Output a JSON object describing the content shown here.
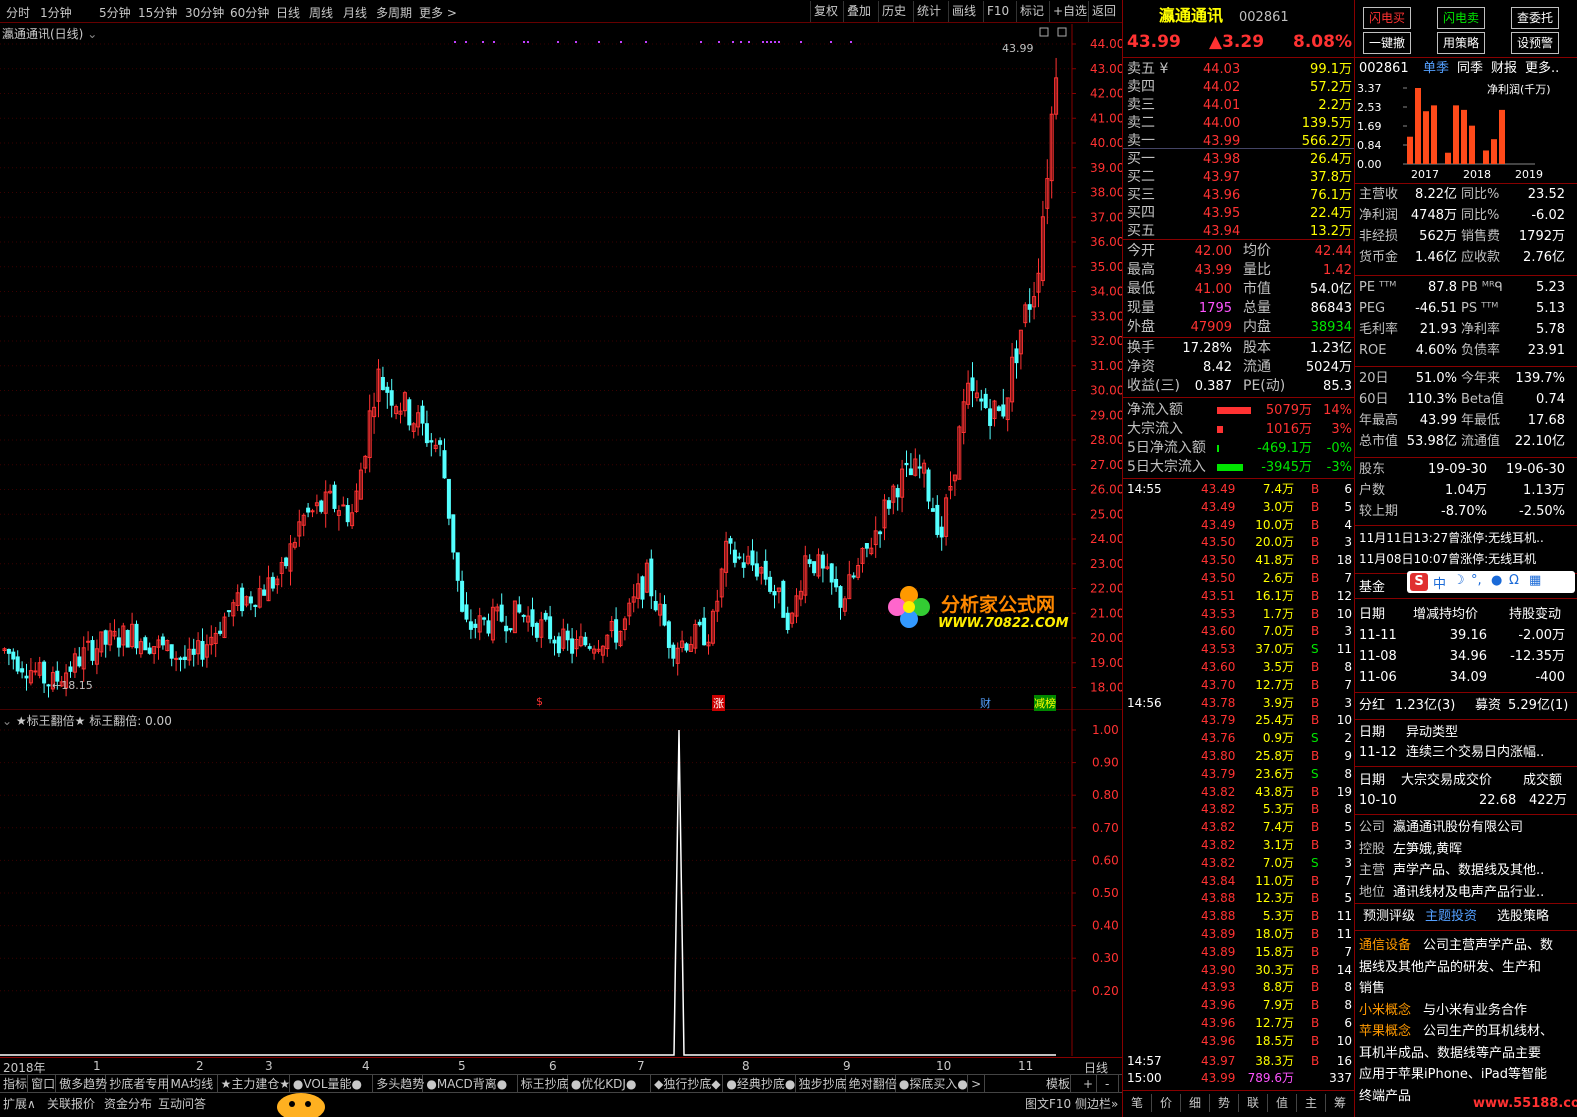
{
  "topbar": {
    "periods": [
      "分时",
      "1分钟",
      "5分钟",
      "15分钟",
      "30分钟",
      "60分钟",
      "日线",
      "周线",
      "月线",
      "多周期",
      "更多 >"
    ],
    "tools": [
      "复权",
      "叠加",
      "历史",
      "统计",
      "画线",
      "F10",
      "标记",
      "+自选",
      "返回"
    ]
  },
  "chart": {
    "title": "瀛通通讯(日线)",
    "last_price_label": "43.99",
    "low_label": "←18.15",
    "y_ticks": [
      "44.00",
      "43.00",
      "42.00",
      "41.00",
      "40.00",
      "39.00",
      "38.00",
      "37.00",
      "36.00",
      "35.00",
      "34.00",
      "33.00",
      "32.00",
      "31.00",
      "30.00",
      "29.00",
      "28.00",
      "27.00",
      "26.00",
      "25.00",
      "24.00",
      "23.00",
      "22.00",
      "21.00",
      "20.00",
      "19.00",
      "18.00"
    ],
    "markers": [
      "$",
      "涨",
      "财",
      "减榜"
    ],
    "watermark_title": "分析家公式网",
    "watermark_url": "WWW.70822.COM"
  },
  "indicator": {
    "title": "★标王翻倍★",
    "label": "标王翻倍: 0.00",
    "y_ticks": [
      "1.00",
      "0.90",
      "0.80",
      "0.70",
      "0.60",
      "0.50",
      "0.40",
      "0.30",
      "0.20"
    ]
  },
  "xaxis": {
    "labels": [
      "2018年",
      "1",
      "2",
      "3",
      "4",
      "5",
      "6",
      "7",
      "8",
      "9",
      "10",
      "11"
    ],
    "right": "日线"
  },
  "indicator_tabs": [
    "指标",
    "窗口",
    "傲多趋势",
    "抄底者专用",
    "MA均线",
    "★主力建仓★",
    "●VOL量能●",
    "多头趋势",
    "●MACD背离●",
    "标王抄底",
    "●优化KDJ●",
    "◆独行抄底◆",
    "●经典抄底●",
    "独步抄底",
    "绝对翻倍",
    "●探底买入●",
    ">",
    "模板",
    "+",
    "-"
  ],
  "bottom_tabs": [
    "扩展∧",
    "关联报价",
    "资金分布",
    "互动问答"
  ],
  "bottom_right": "图文F10 侧边栏»",
  "chart_data": {
    "type": "candlestick",
    "title": "瀛通通讯(日线)",
    "ylim": [
      18.0,
      44.0
    ],
    "last": 43.99,
    "low": 18.15,
    "high_2018": 30.6,
    "indicator": {
      "name": "标王翻倍",
      "ylim": [
        0,
        1.0
      ],
      "spike_value": 1.0,
      "current": 0.0
    }
  },
  "quote": {
    "name": "瀛通通讯",
    "code": "002861",
    "price": "43.99",
    "change": "▲3.29",
    "pct": "8.08%",
    "asks": [
      [
        "卖五 ¥",
        "44.03",
        "99.1万"
      ],
      [
        "卖四",
        "44.02",
        "57.2万"
      ],
      [
        "卖三",
        "44.01",
        "2.2万"
      ],
      [
        "卖二",
        "44.00",
        "139.5万"
      ],
      [
        "卖一",
        "43.99",
        "566.2万"
      ]
    ],
    "bids": [
      [
        "买一",
        "43.98",
        "26.4万"
      ],
      [
        "买二",
        "43.97",
        "37.8万"
      ],
      [
        "买三",
        "43.96",
        "76.1万"
      ],
      [
        "买四",
        "43.95",
        "22.4万"
      ],
      [
        "买五",
        "43.94",
        "13.2万"
      ]
    ],
    "stats": [
      [
        "今开",
        "42.00",
        "均价",
        "42.44"
      ],
      [
        "最高",
        "43.99",
        "量比",
        "1.42"
      ],
      [
        "最低",
        "41.00",
        "市值",
        "54.0亿"
      ],
      [
        "现量",
        "1795",
        "总量",
        "86843"
      ],
      [
        "外盘",
        "47909",
        "内盘",
        "38934"
      ]
    ],
    "stats2": [
      [
        "换手",
        "17.28%",
        "股本",
        "1.23亿"
      ],
      [
        "净资",
        "8.42",
        "流通",
        "5024万"
      ],
      [
        "收益(三)",
        "0.387",
        "PE(动)",
        "85.3"
      ]
    ],
    "flows": [
      [
        "净流入额",
        "5079万",
        "14%"
      ],
      [
        "大宗流入",
        "1016万",
        "3%"
      ],
      [
        "5日净流入额",
        "-469.1万",
        "-0%"
      ],
      [
        "5日大宗流入",
        "-3945万",
        "-3%"
      ]
    ],
    "ticks": [
      [
        "14:55",
        "43.49",
        "7.4万",
        "B",
        "6"
      ],
      [
        "",
        "43.49",
        "3.0万",
        "B",
        "5"
      ],
      [
        "",
        "43.49",
        "10.0万",
        "B",
        "4"
      ],
      [
        "",
        "43.50",
        "20.0万",
        "B",
        "3"
      ],
      [
        "",
        "43.50",
        "41.8万",
        "B",
        "18"
      ],
      [
        "",
        "43.50",
        "2.6万",
        "B",
        "7"
      ],
      [
        "",
        "43.51",
        "16.1万",
        "B",
        "12"
      ],
      [
        "",
        "43.53",
        "1.7万",
        "B",
        "10"
      ],
      [
        "",
        "43.60",
        "7.0万",
        "B",
        "3"
      ],
      [
        "",
        "43.53",
        "37.0万",
        "S",
        "11"
      ],
      [
        "",
        "43.60",
        "3.5万",
        "B",
        "8"
      ],
      [
        "",
        "43.70",
        "12.7万",
        "B",
        "7"
      ],
      [
        "14:56",
        "43.78",
        "3.9万",
        "B",
        "3"
      ],
      [
        "",
        "43.79",
        "25.4万",
        "B",
        "10"
      ],
      [
        "",
        "43.76",
        "0.9万",
        "S",
        "2"
      ],
      [
        "",
        "43.80",
        "25.8万",
        "B",
        "9"
      ],
      [
        "",
        "43.79",
        "23.6万",
        "S",
        "8"
      ],
      [
        "",
        "43.82",
        "43.8万",
        "B",
        "19"
      ],
      [
        "",
        "43.82",
        "5.3万",
        "B",
        "8"
      ],
      [
        "",
        "43.82",
        "7.4万",
        "B",
        "5"
      ],
      [
        "",
        "43.82",
        "3.1万",
        "B",
        "3"
      ],
      [
        "",
        "43.82",
        "7.0万",
        "S",
        "3"
      ],
      [
        "",
        "43.84",
        "11.0万",
        "B",
        "7"
      ],
      [
        "",
        "43.88",
        "12.3万",
        "B",
        "5"
      ],
      [
        "",
        "43.88",
        "5.3万",
        "B",
        "11"
      ],
      [
        "",
        "43.89",
        "18.0万",
        "B",
        "11"
      ],
      [
        "",
        "43.89",
        "15.8万",
        "B",
        "7"
      ],
      [
        "",
        "43.90",
        "30.3万",
        "B",
        "14"
      ],
      [
        "",
        "43.93",
        "8.8万",
        "B",
        "8"
      ],
      [
        "",
        "43.96",
        "7.9万",
        "B",
        "8"
      ],
      [
        "",
        "43.96",
        "12.7万",
        "B",
        "6"
      ],
      [
        "",
        "43.96",
        "18.5万",
        "B",
        "10"
      ],
      [
        "14:57",
        "43.97",
        "38.3万",
        "B",
        "16"
      ],
      [
        "15:00",
        "43.99",
        "789.6万",
        "",
        "337"
      ]
    ],
    "tabs": [
      "笔",
      "价",
      "细",
      "势",
      "联",
      "值",
      "主",
      "筹"
    ]
  },
  "f10": {
    "buttons": [
      "闪电买",
      "闪电卖",
      "查委托",
      "一键撤",
      "用策略",
      "设预警"
    ],
    "code": "002861",
    "tabs": [
      "单季",
      "同季",
      "财报",
      "更多.."
    ],
    "bar_title": "净利润(千万)",
    "bar_y": [
      "3.37",
      "2.53",
      "1.69",
      "0.84",
      "0.00"
    ],
    "bar_x": [
      "2017",
      "2018",
      "2019"
    ],
    "fin": [
      [
        "主营收",
        "8.22亿",
        "同比%",
        "23.52"
      ],
      [
        "净利润",
        "4748万",
        "同比%",
        "-6.02"
      ],
      [
        "非经损",
        "562万",
        "销售费",
        "1792万"
      ],
      [
        "货币金",
        "1.46亿",
        "应收款",
        "2.76亿"
      ]
    ],
    "val": [
      [
        "PE ᵀᵀᴹ",
        "87.8",
        "PB ᴹᴿᑫ",
        "5.23"
      ],
      [
        "PEG",
        "-46.51",
        "PS ᵀᵀᴹ",
        "5.13"
      ],
      [
        "毛利率",
        "21.93",
        "净利率",
        "5.78"
      ],
      [
        "ROE",
        "4.60%",
        "负债率",
        "23.91"
      ]
    ],
    "perf": [
      [
        "20日",
        "51.0%",
        "今年来",
        "139.7%"
      ],
      [
        "60日",
        "110.3%",
        "Beta值",
        "0.74"
      ],
      [
        "年最高",
        "43.99",
        "年最低",
        "17.68"
      ],
      [
        "总市值",
        "53.98亿",
        "流通值",
        "22.10亿"
      ]
    ],
    "holders": [
      [
        "股东",
        "19-09-30",
        "19-06-30"
      ],
      [
        "户数",
        "1.04万",
        "1.13万"
      ],
      [
        "较上期",
        "-8.70%",
        "-2.50%"
      ]
    ],
    "news": [
      "11月11日13:27曾涨停:无线耳机..",
      "11月08日10:07曾涨停:无线耳机"
    ],
    "fund_label": "基金",
    "fund_head": [
      "日期",
      "增减持均价",
      "持股变动"
    ],
    "fund": [
      [
        "11-11",
        "39.16",
        "-2.00万"
      ],
      [
        "11-08",
        "34.96",
        "-12.35万"
      ],
      [
        "11-06",
        "34.09",
        "-400"
      ]
    ],
    "dividend": [
      "分红",
      "1.23亿(3)",
      "募资",
      "5.29亿(1)"
    ],
    "abn_head": [
      "日期",
      "异动类型"
    ],
    "abn": [
      "11-12",
      "连续三个交易日内涨幅.."
    ],
    "blk_head": [
      "日期",
      "大宗交易成交价",
      "成交额"
    ],
    "blk": [
      "10-10",
      "22.68",
      "422万"
    ],
    "company": [
      [
        "公司",
        "瀛通通讯股份有限公司"
      ],
      [
        "控股",
        "左笋娥,黄晖"
      ],
      [
        "主营",
        "声学产品、数据线及其他.."
      ],
      [
        "地位",
        "通讯线材及电声产品行业.."
      ]
    ],
    "tabs2": [
      "预测评级",
      "主题投资",
      "选股策略"
    ],
    "themes": [
      [
        "通信设备",
        "公司主营声学产品、数"
      ],
      [
        "",
        "据线及其他产品的研发、生产和"
      ],
      [
        "",
        "销售"
      ],
      [
        "小米概念",
        "与小米有业务合作"
      ],
      [
        "苹果概念",
        "公司生产的耳机线材、"
      ],
      [
        "",
        "耳机半成品、数据线等产品主要"
      ],
      [
        "",
        "应用于苹果iPhone、iPad等智能"
      ],
      [
        "",
        "终端产品"
      ]
    ],
    "ime": "中",
    "footer_url": "www.55188.com"
  }
}
